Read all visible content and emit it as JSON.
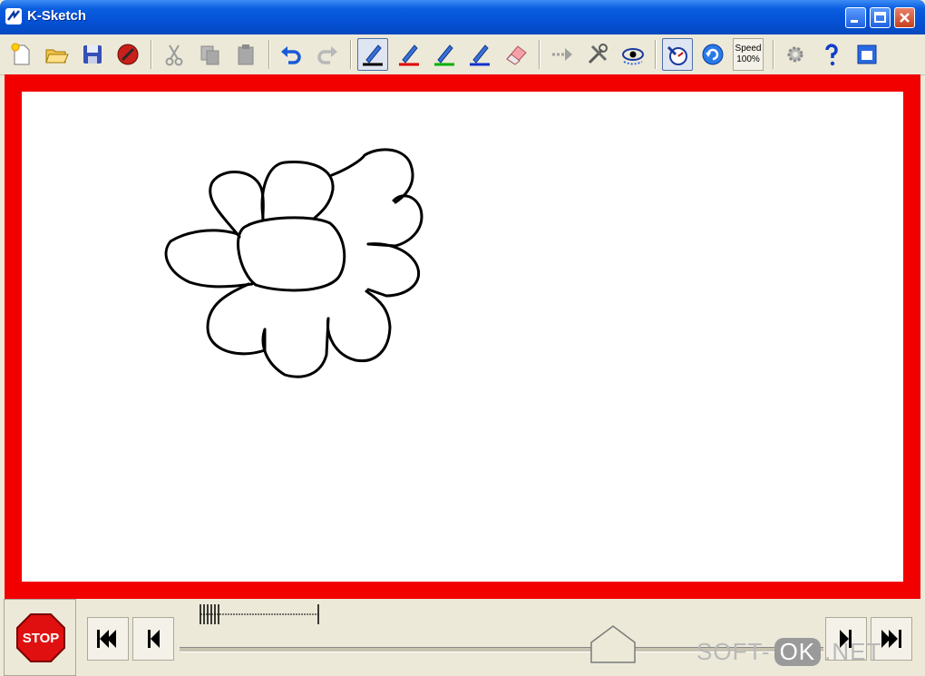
{
  "window": {
    "title": "K-Sketch",
    "controls": [
      "minimize-icon",
      "maximize-icon",
      "close-icon"
    ]
  },
  "toolbar": {
    "file_group": [
      "new-file-icon",
      "open-file-icon",
      "save-icon",
      "no-entry-icon"
    ],
    "edit_group": [
      "cut-icon",
      "copy-icon",
      "paste-icon"
    ],
    "history_group": [
      "undo-icon",
      "redo-icon"
    ],
    "pen_colors": [
      "#000000",
      "#e00000",
      "#00b000",
      "#1030d0"
    ],
    "eraser": "eraser-icon",
    "tools_group": [
      "move-path-icon",
      "tools-icon",
      "show-paths-icon"
    ],
    "playback_group": [
      "timer-icon",
      "loop-icon"
    ],
    "speed_label": "Speed",
    "speed_value": "100%",
    "misc_group": [
      "settings-icon",
      "help-icon",
      "fullscreen-icon"
    ]
  },
  "canvas": {
    "frame_color": "#f20000",
    "background": "#ffffff",
    "drawing": "flower-sketch"
  },
  "bottom_bar": {
    "stop_label": "STOP",
    "nav_left": [
      "first-frame-icon",
      "previous-frame-icon"
    ],
    "nav_right": [
      "next-frame-icon",
      "last-frame-icon"
    ],
    "slider": "timeline-slider"
  },
  "watermark": {
    "part1": "SOFT-",
    "part2": "OK",
    "part3": ".NET"
  }
}
